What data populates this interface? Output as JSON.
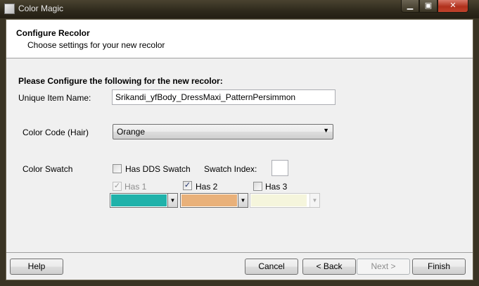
{
  "window": {
    "title": "Color Magic",
    "min_glyph": "▁",
    "max_glyph": "▣",
    "close_glyph": "✕"
  },
  "header": {
    "title": "Configure Recolor",
    "subtitle": "Choose settings for your new recolor"
  },
  "form": {
    "section_title": "Please Configure the following for the new recolor:",
    "unique_name_label": "Unique Item Name:",
    "unique_name_value": "Srikandi_yfBody_DressMaxi_PatternPersimmon",
    "color_code_label": "Color Code (Hair)",
    "color_code_value": "Orange",
    "color_swatch_label": "Color Swatch",
    "has_dds_label": "Has DDS Swatch",
    "swatch_index_label": "Swatch Index:",
    "swatch_index_value": "",
    "has1_label": "Has 1",
    "has2_label": "Has 2",
    "has3_label": "Has 3",
    "has1_checked": true,
    "has2_checked": true,
    "has3_checked": false,
    "has_dds_checked": false,
    "swatch_colors": [
      "#20b2aa",
      "#e9b17a",
      "#f5f5dc"
    ],
    "check_glyph": "✓",
    "arrow_glyph": "▼"
  },
  "buttons": {
    "help": "Help",
    "cancel": "Cancel",
    "back": "< Back",
    "next": "Next >",
    "finish": "Finish"
  }
}
